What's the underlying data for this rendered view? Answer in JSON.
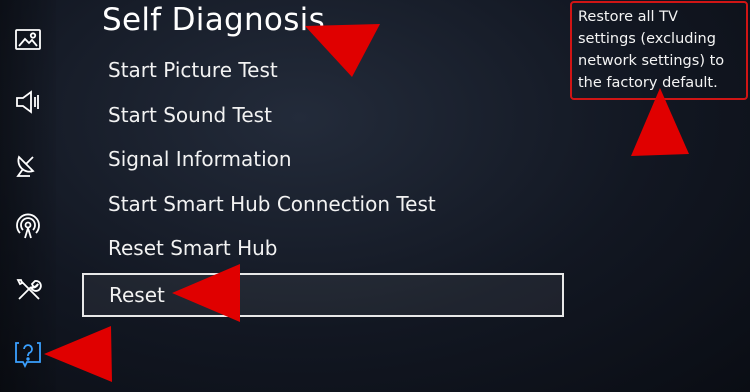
{
  "page": {
    "title": "Self Diagnosis",
    "description": "Restore all TV settings (excluding network settings) to the factory default."
  },
  "menu": {
    "items": [
      {
        "label": "Start Picture Test"
      },
      {
        "label": "Start Sound Test"
      },
      {
        "label": "Signal Information"
      },
      {
        "label": "Start Smart Hub Connection Test"
      },
      {
        "label": "Reset Smart Hub"
      },
      {
        "label": "Reset"
      }
    ],
    "selected_index": 5
  },
  "sidebar": {
    "icons": [
      "picture-icon",
      "sound-icon",
      "broadcasting-icon",
      "network-icon",
      "system-icon",
      "support-icon"
    ],
    "selected_icon": "support-icon"
  },
  "colors": {
    "annotation": "#e00000",
    "highlight_box": "#e8e8e8",
    "support_icon": "#3aa0ff"
  }
}
